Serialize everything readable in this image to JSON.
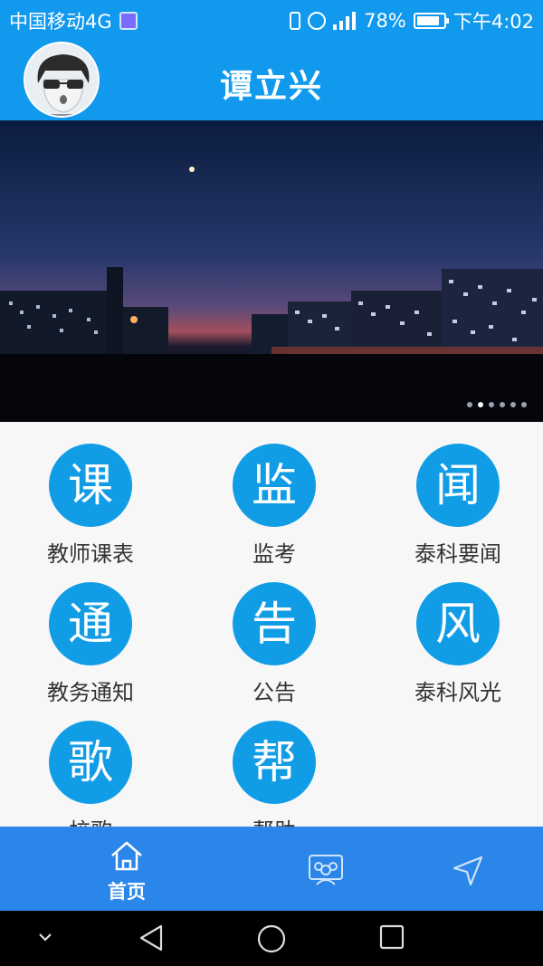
{
  "status_bar": {
    "carrier": "中国移动4G",
    "network": "4G",
    "battery": "78%",
    "time": "下午4:02"
  },
  "header": {
    "title": "谭立兴",
    "avatar_icon": "avatar-icon"
  },
  "banner": {
    "slide_count": 6,
    "active_index": 1
  },
  "grid": {
    "items": [
      {
        "glyph": "课",
        "label": "教师课表",
        "icon": "course-icon"
      },
      {
        "glyph": "监",
        "label": "监考",
        "icon": "proctor-icon"
      },
      {
        "glyph": "闻",
        "label": "泰科要闻",
        "icon": "news-icon"
      },
      {
        "glyph": "通",
        "label": "教务通知",
        "icon": "notice-icon"
      },
      {
        "glyph": "告",
        "label": "公告",
        "icon": "announcement-icon"
      },
      {
        "glyph": "风",
        "label": "泰科风光",
        "icon": "scenery-icon"
      },
      {
        "glyph": "歌",
        "label": "校歌",
        "icon": "song-icon"
      },
      {
        "glyph": "帮",
        "label": "帮助",
        "icon": "help-icon"
      }
    ]
  },
  "bottom_nav": {
    "home_label": "首页",
    "items": [
      "home-icon",
      "group-icon",
      "send-icon"
    ]
  },
  "colors": {
    "primary": "#1199ee",
    "nav_bg": "#2a86e8",
    "circle": "#119de6"
  }
}
